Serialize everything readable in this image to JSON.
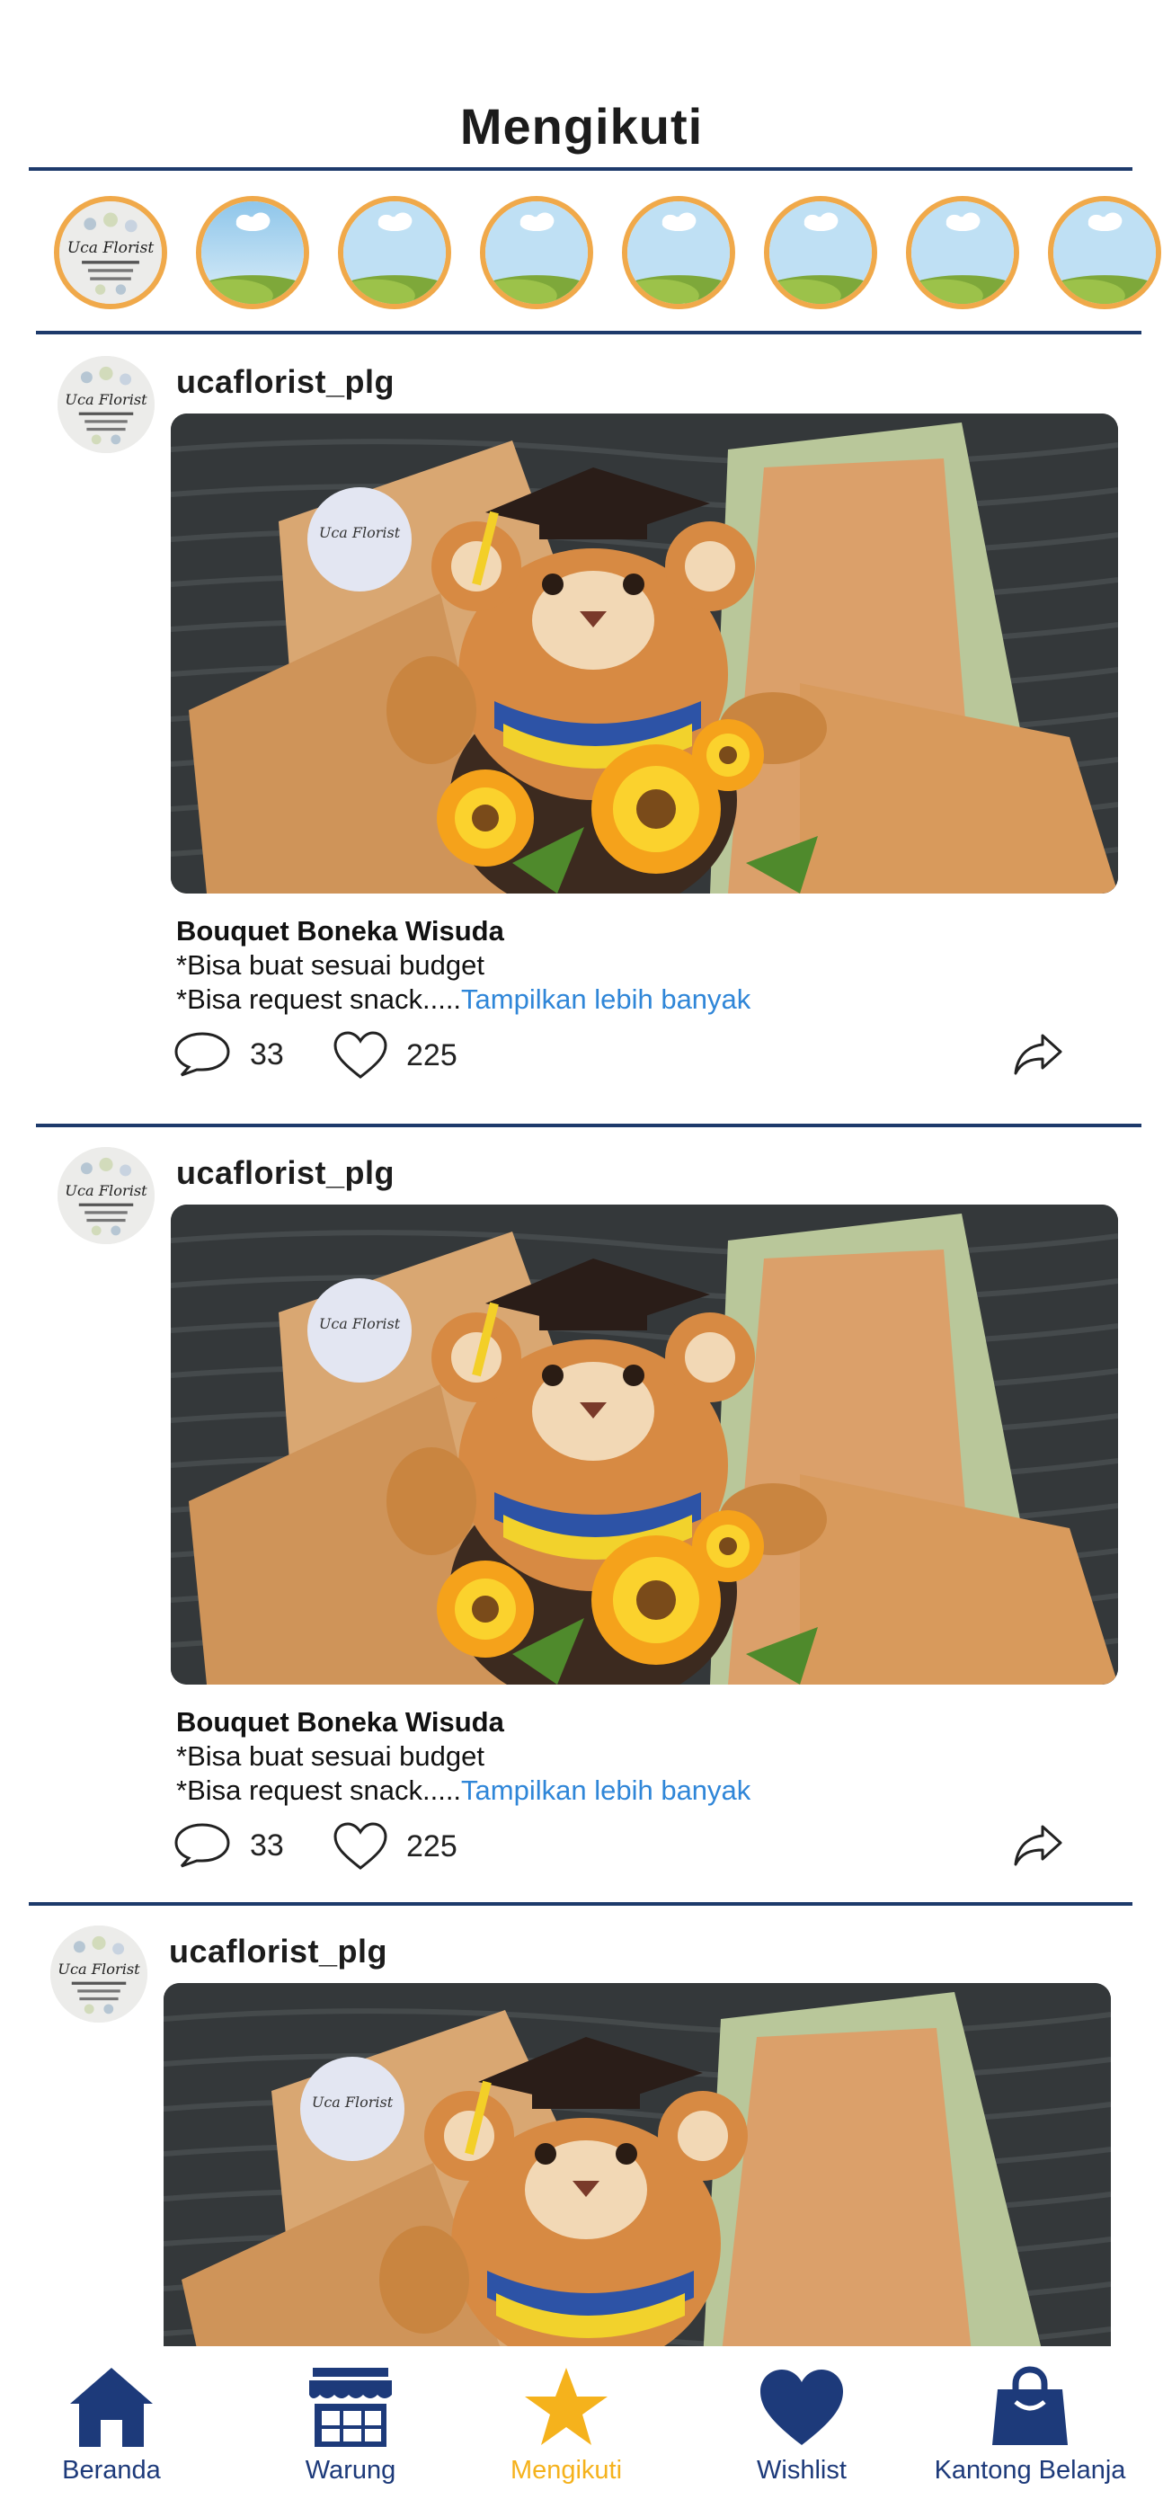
{
  "header": {
    "title": "Mengikuti"
  },
  "stories": {
    "count_visible": 8
  },
  "colors": {
    "accent_nav": "#1d3a7a",
    "active_nav": "#f5b21c",
    "link": "#2f86d8",
    "story_ring": "#f0a94a"
  },
  "posts": [
    {
      "username": "ucaflorist_plg",
      "title": "Bouquet Boneka Wisuda",
      "line1": "*Bisa buat sesuai budget",
      "line2": "*Bisa request snack.....",
      "more": "Tampilkan lebih banyak",
      "comments": "33",
      "likes": "225"
    },
    {
      "username": "ucaflorist_plg",
      "title": "Bouquet Boneka Wisuda",
      "line1": "*Bisa buat sesuai budget",
      "line2": "*Bisa request snack.....",
      "more": "Tampilkan lebih banyak",
      "comments": "33",
      "likes": "225"
    },
    {
      "username": "ucaflorist_plg"
    }
  ],
  "nav": {
    "items": [
      {
        "label": "Beranda",
        "icon": "home-icon"
      },
      {
        "label": "Warung",
        "icon": "store-icon"
      },
      {
        "label": "Mengikuti",
        "icon": "star-icon",
        "active": true
      },
      {
        "label": "Wishlist",
        "icon": "heart-icon"
      },
      {
        "label": "Kantong Belanja",
        "icon": "shopping-bag-icon"
      }
    ]
  },
  "logo": {
    "text": "Uca Florist"
  }
}
